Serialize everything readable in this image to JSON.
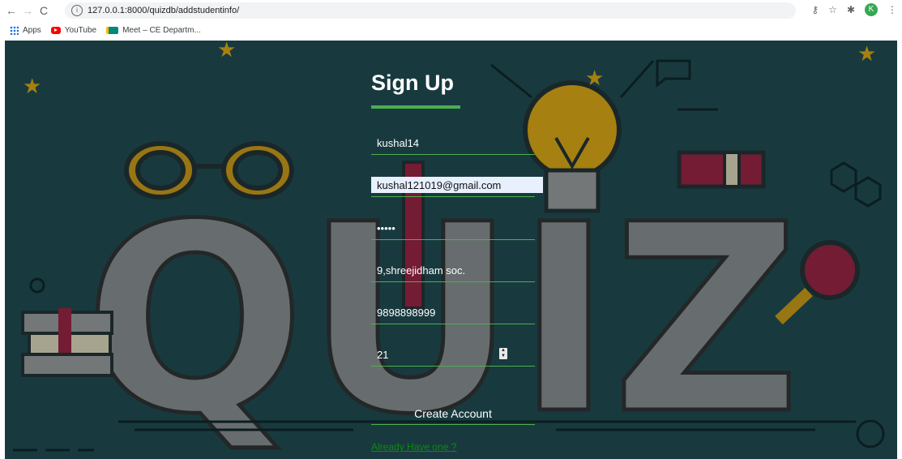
{
  "browser": {
    "url": "127.0.0.1:8000/quizdb/addstudentinfo/",
    "avatar_letter": "K",
    "bookmarks": [
      {
        "label": "Apps",
        "icon": "apps-grid-icon"
      },
      {
        "label": "YouTube",
        "icon": "youtube-icon"
      },
      {
        "label": "Meet – CE Departm...",
        "icon": "meet-icon"
      }
    ]
  },
  "page": {
    "background_text": "QUIZ",
    "title": "Sign Up",
    "accent_color": "#4caf50",
    "fields": {
      "username": {
        "value": "kushal14"
      },
      "email": {
        "value": "kushal121019@gmail.com"
      },
      "password": {
        "value": "•••••"
      },
      "address": {
        "value": "9,shreejidham soc."
      },
      "phone": {
        "value": "9898898999"
      },
      "age": {
        "value": "21"
      }
    },
    "submit_label": "Create Account",
    "login_link": "Already Have one ?"
  }
}
